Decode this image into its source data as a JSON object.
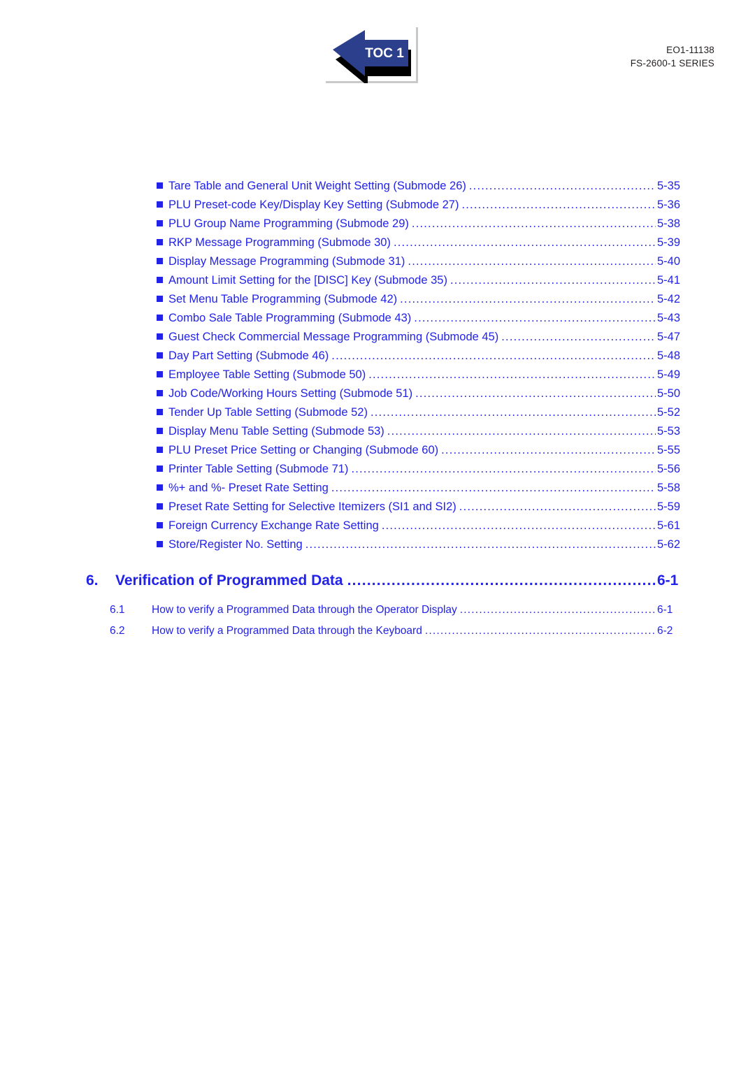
{
  "header": {
    "doc_id": "EO1-11138",
    "series": "FS-2600-1 SERIES",
    "badge_label": "TOC 1",
    "badge_icon": "left-arrow-toc-icon",
    "accent_color": "#2222e8",
    "badge_fill": "#2b3f8c",
    "header_text_color": "#231f20"
  },
  "toc": {
    "bullet_glyph": "filled-square",
    "entries": [
      {
        "title": "Tare Table and General Unit Weight Setting (Submode 26)",
        "page": "5-35"
      },
      {
        "title": "PLU Preset-code Key/Display Key Setting (Submode 27)",
        "page": "5-36"
      },
      {
        "title": "PLU Group Name Programming  (Submode 29)",
        "page": "5-38"
      },
      {
        "title": "RKP Message Programming  (Submode 30)",
        "page": "5-39"
      },
      {
        "title": "Display Message Programming  (Submode 31)",
        "page": "5-40"
      },
      {
        "title": "Amount Limit Setting for the [DISC] Key (Submode 35)",
        "page": "5-41"
      },
      {
        "title": "Set Menu Table Programming (Submode 42)",
        "page": "5-42"
      },
      {
        "title": "Combo Sale Table Programming (Submode 43)",
        "page": "5-43"
      },
      {
        "title": "Guest Check Commercial Message Programming (Submode 45)",
        "page": "5-47"
      },
      {
        "title": "Day Part Setting (Submode 46)",
        "page": "5-48"
      },
      {
        "title": "Employee Table Setting (Submode 50)",
        "page": "5-49"
      },
      {
        "title": "Job Code/Working Hours Setting (Submode 51)",
        "page": "5-50"
      },
      {
        "title": "Tender Up Table Setting (Submode 52)",
        "page": "5-52"
      },
      {
        "title": "Display Menu Table Setting (Submode 53)",
        "page": "5-53"
      },
      {
        "title": "PLU Preset Price Setting or Changing (Submode 60)",
        "page": "5-55"
      },
      {
        "title": "Printer Table Setting (Submode 71)",
        "page": "5-56"
      },
      {
        "title": "%+ and %- Preset Rate Setting",
        "page": "5-58"
      },
      {
        "title": "Preset Rate Setting for Selective Itemizers (SI1 and SI2)",
        "page": "5-59"
      },
      {
        "title": "Foreign Currency Exchange Rate Setting",
        "page": "5-61"
      },
      {
        "title": "Store/Register No. Setting",
        "page": "5-62"
      }
    ]
  },
  "section6": {
    "number": "6.",
    "title": "Verification of Programmed Data",
    "page": "6-1",
    "subsections": [
      {
        "number": "6.1",
        "title": "How to verify a Programmed Data through the Operator Display",
        "page": "6-1"
      },
      {
        "number": "6.2",
        "title": "How to verify a Programmed Data through the Keyboard",
        "page": "6-2"
      }
    ]
  }
}
